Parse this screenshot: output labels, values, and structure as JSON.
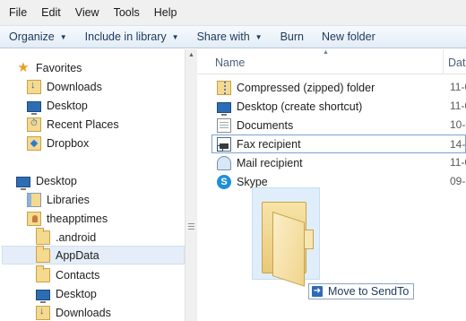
{
  "menubar": {
    "items": [
      "File",
      "Edit",
      "View",
      "Tools",
      "Help"
    ]
  },
  "toolbar": {
    "organize": "Organize",
    "include_in_library": "Include in library",
    "share_with": "Share with",
    "burn": "Burn",
    "new_folder": "New folder"
  },
  "nav": {
    "favorites": "Favorites",
    "favorites_items": [
      "Downloads",
      "Desktop",
      "Recent Places",
      "Dropbox"
    ],
    "desktop": "Desktop",
    "libraries": "Libraries",
    "user": "theapptimes",
    "user_items": [
      ".android",
      "AppData",
      "Contacts",
      "Desktop",
      "Downloads"
    ]
  },
  "columns": {
    "name": "Name",
    "date": "Date"
  },
  "files": [
    {
      "name": "Compressed (zipped) folder",
      "date": "11-0"
    },
    {
      "name": "Desktop (create shortcut)",
      "date": "11-0"
    },
    {
      "name": "Documents",
      "date": "10-0"
    },
    {
      "name": "Fax recipient",
      "date": "14-0"
    },
    {
      "name": "Mail recipient",
      "date": "11-0"
    },
    {
      "name": "Skype",
      "date": "09-1"
    }
  ],
  "drag_tooltip": {
    "label": "Move to SendTo"
  }
}
